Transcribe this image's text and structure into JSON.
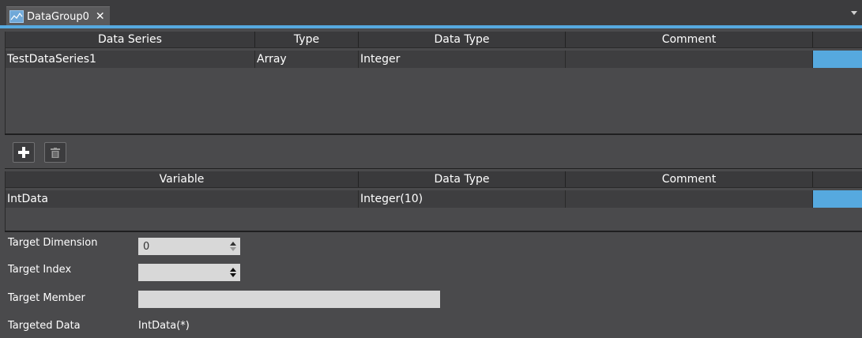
{
  "tab": {
    "title": "DataGroup0",
    "close": "✕"
  },
  "series_table": {
    "headers": [
      "Data Series",
      "Type",
      "Data Type",
      "Comment"
    ],
    "rows": [
      {
        "data_series": "TestDataSeries1",
        "type": "Array",
        "data_type": "Integer",
        "comment": ""
      }
    ]
  },
  "toolbar": {
    "add_icon": "plus-icon",
    "delete_icon": "trash-icon"
  },
  "variable_table": {
    "headers": [
      "Variable",
      "Data Type",
      "Comment"
    ],
    "rows": [
      {
        "variable": "IntData",
        "data_type": "Integer(10)",
        "comment": ""
      }
    ]
  },
  "props": {
    "target_dimension_label": "Target Dimension",
    "target_dimension_value": "0",
    "target_index_label": "Target Index",
    "target_index_value": "",
    "target_member_label": "Target Member",
    "target_member_value": "",
    "targeted_data_label": "Targeted Data",
    "targeted_data_value": "IntData(*)"
  },
  "colors": {
    "accent": "#56a9df",
    "background": "#4a4a4c",
    "tabbar": "#3c3c3e"
  }
}
